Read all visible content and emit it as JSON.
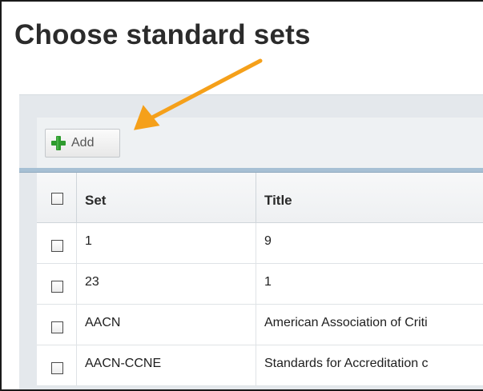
{
  "page": {
    "title": "Choose standard sets"
  },
  "toolbar": {
    "add_label": "Add",
    "add_icon": "plus-icon"
  },
  "table": {
    "columns": [
      "Set",
      "Title"
    ],
    "rows": [
      {
        "set": "1",
        "title": "9"
      },
      {
        "set": "23",
        "title": "1"
      },
      {
        "set": "AACN",
        "title": "American Association of Criti"
      },
      {
        "set": "AACN-CCNE",
        "title": "Standards for Accreditation c"
      }
    ]
  },
  "colors": {
    "annotation_arrow": "#f5a01a",
    "add_icon_green": "#2e9b2e",
    "separator": "#a7c0d4"
  }
}
